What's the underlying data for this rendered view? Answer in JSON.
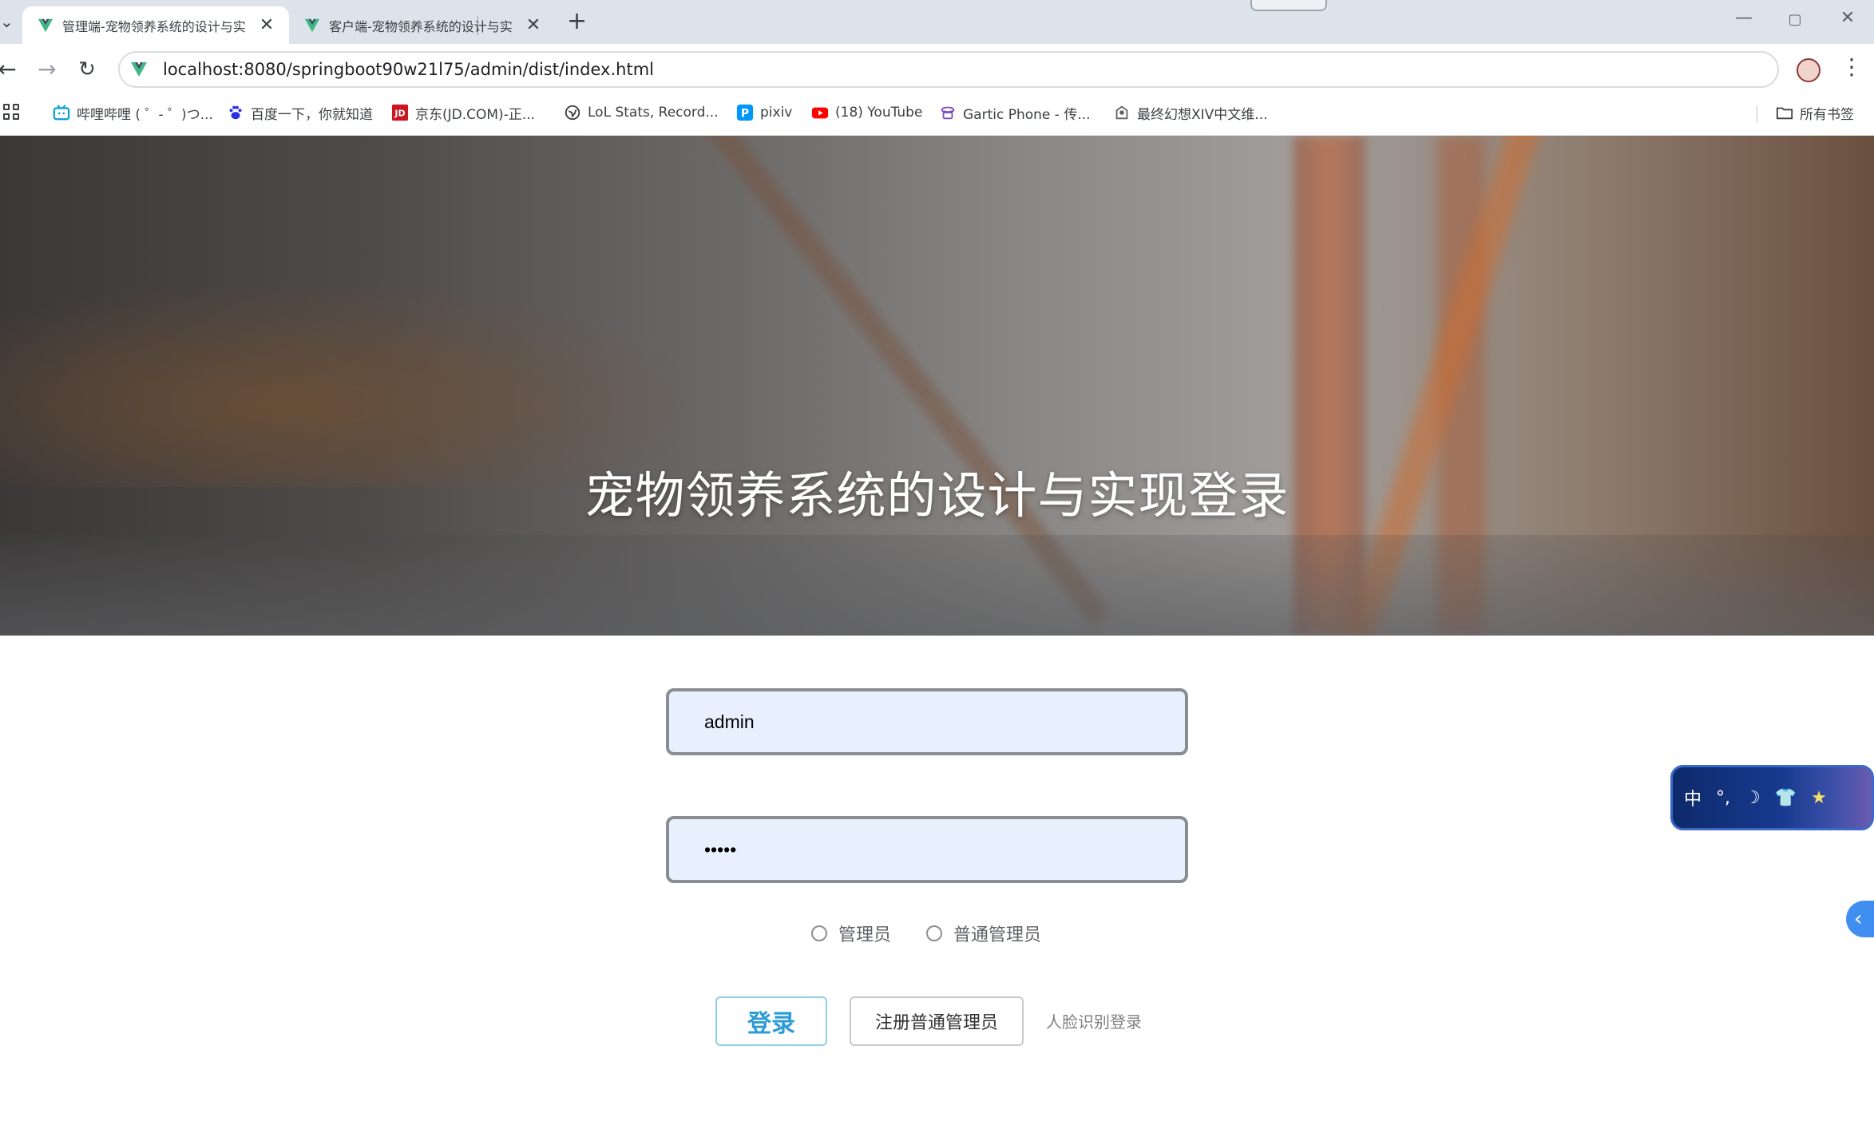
{
  "browser": {
    "tabs": [
      {
        "title": "管理端-宠物领养系统的设计与实",
        "active": true
      },
      {
        "title": "客户端-宠物领养系统的设计与实",
        "active": false
      }
    ],
    "new_tab_symbol": "+",
    "window_controls": [
      "—",
      "▢",
      "✕"
    ],
    "url": "localhost:8080/springboot90w21l75/admin/dist/index.html",
    "bookmarks": [
      {
        "label": "哔哩哔哩 ( ゜- ゜)つ...",
        "icon": "bilibili-icon",
        "color": "#00a1d6"
      },
      {
        "label": "百度一下，你就知道",
        "icon": "baidu-icon",
        "color": "#2932e1"
      },
      {
        "label": "京东(JD.COM)-正...",
        "icon": "jd-icon",
        "color": "#c91623"
      },
      {
        "label": "LoL Stats, Record...",
        "icon": "globe-icon",
        "color": "#3c4043"
      },
      {
        "label": "pixiv",
        "icon": "pixiv-icon",
        "color": "#0096fa"
      },
      {
        "label": "(18) YouTube",
        "icon": "youtube-icon",
        "color": "#ff0000"
      },
      {
        "label": "Gartic Phone - 传...",
        "icon": "gartic-icon",
        "color": "#7b4fbd"
      },
      {
        "label": "最终幻想XIV中文维...",
        "icon": "ffxiv-icon",
        "color": "#5f6368"
      }
    ],
    "all_bookmarks_label": "所有书签"
  },
  "page": {
    "title": "宠物领养系统的设计与实现登录",
    "form": {
      "username_value": "admin",
      "password_value": "admin",
      "roles": [
        {
          "label": "管理员",
          "selected": false
        },
        {
          "label": "普通管理员",
          "selected": false
        }
      ],
      "login_label": "登录",
      "register_label": "注册普通管理员",
      "face_login_label": "人脸识别登录"
    }
  },
  "widgets": {
    "ime_items": [
      "中",
      "°,",
      "☽",
      "👕",
      "★"
    ],
    "side_tab_symbol": "‹"
  },
  "colors": {
    "accent": "#2d9bd6",
    "input_bg": "#e8f0fe"
  }
}
